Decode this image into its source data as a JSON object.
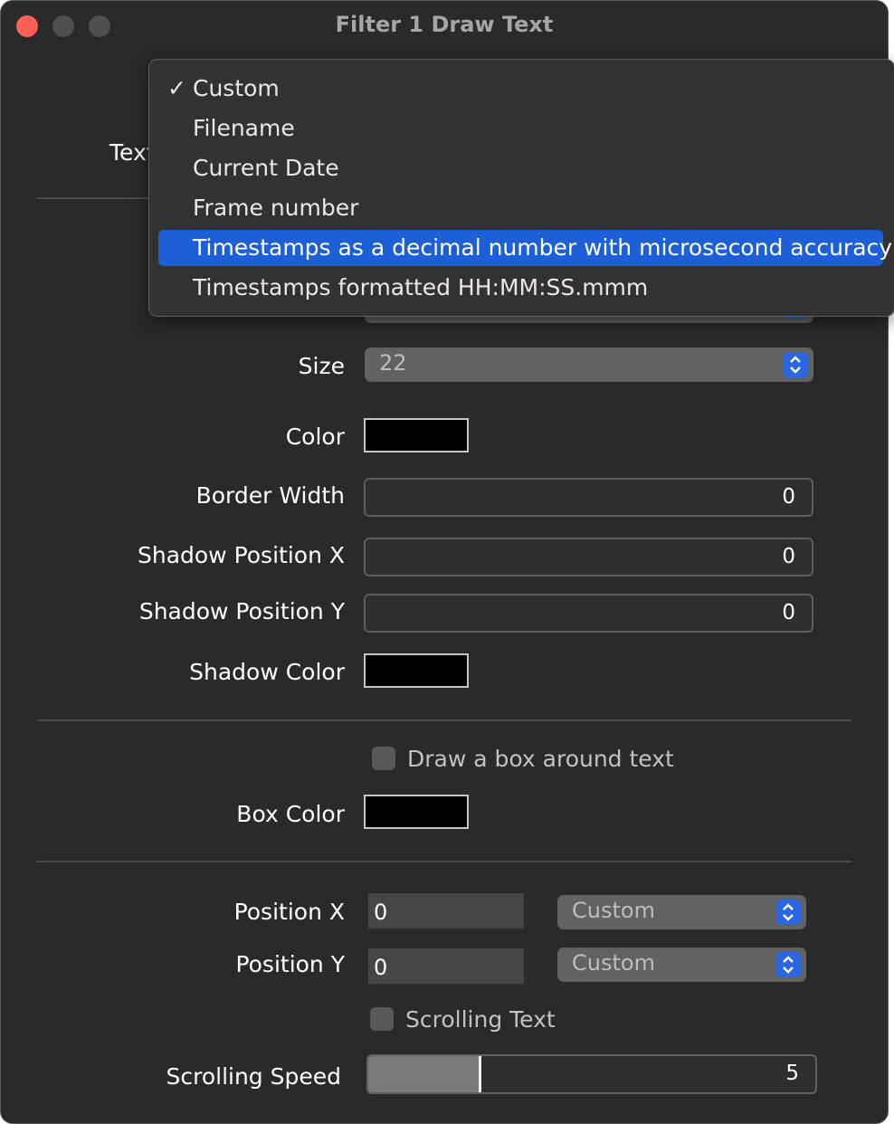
{
  "window": {
    "title": "Filter 1 Draw Text"
  },
  "text_row": {
    "label": "Text"
  },
  "size": {
    "label": "Size",
    "value": "22"
  },
  "color": {
    "label": "Color",
    "value": "#000000"
  },
  "border_width": {
    "label": "Border Width",
    "value": "0"
  },
  "shadow_x": {
    "label": "Shadow Position X",
    "value": "0"
  },
  "shadow_y": {
    "label": "Shadow Position Y",
    "value": "0"
  },
  "shadow_color": {
    "label": "Shadow Color",
    "value": "#000000"
  },
  "draw_box": {
    "label": "Draw a box around text",
    "checked": false
  },
  "box_color": {
    "label": "Box Color",
    "value": "#000000"
  },
  "position_x": {
    "label": "Position X",
    "value": "0",
    "mode": "Custom"
  },
  "position_y": {
    "label": "Position Y",
    "value": "0",
    "mode": "Custom"
  },
  "scrolling_text": {
    "label": "Scrolling Text",
    "checked": false
  },
  "scrolling_speed": {
    "label": "Scrolling Speed",
    "value": "5",
    "fraction": 0.25
  },
  "text_menu": {
    "checkmark": "✓",
    "items": [
      {
        "label": "Custom",
        "checked": true,
        "highlighted": false
      },
      {
        "label": "Filename",
        "checked": false,
        "highlighted": false
      },
      {
        "label": "Current Date",
        "checked": false,
        "highlighted": false
      },
      {
        "label": "Frame number",
        "checked": false,
        "highlighted": false
      },
      {
        "label": "Timestamps as a decimal number with microsecond accuracy",
        "checked": false,
        "highlighted": true
      },
      {
        "label": "Timestamps formatted HH:MM:SS.mmm",
        "checked": false,
        "highlighted": false
      }
    ]
  },
  "colors": {
    "window_bg": "#2a2a2a",
    "accent": "#1c5fd6",
    "close": "#fe5f57"
  }
}
